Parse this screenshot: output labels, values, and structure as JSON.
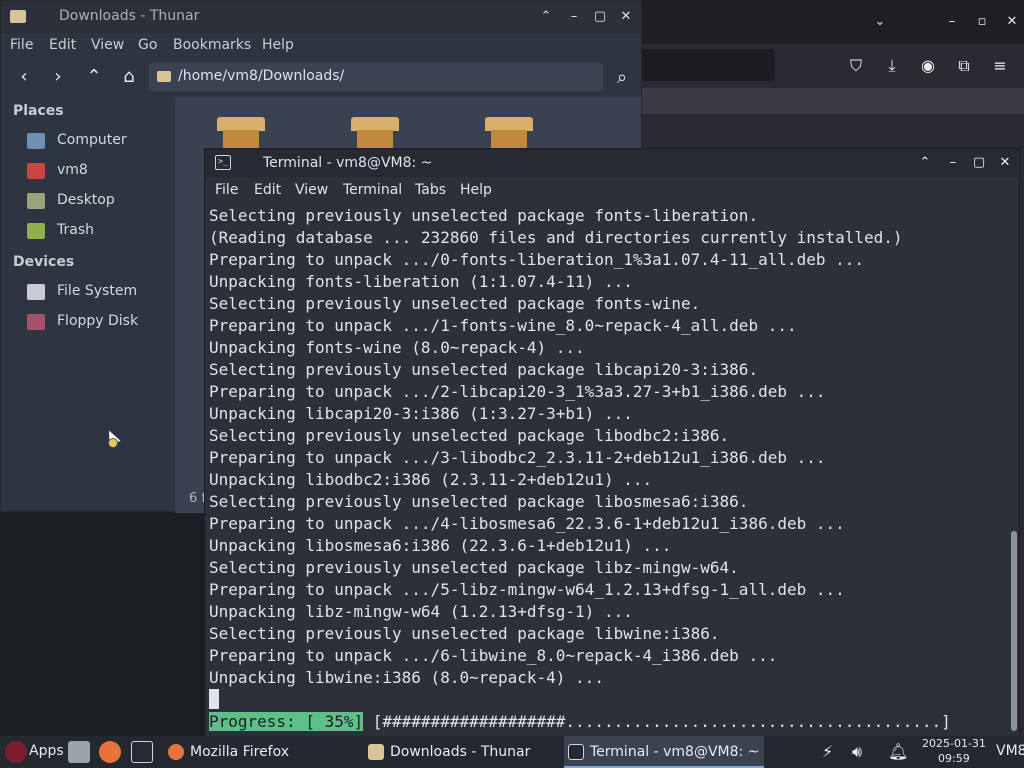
{
  "firefox": {
    "titlebar_controls": [
      "⌄",
      "–",
      "▫",
      "✕"
    ],
    "toolbar_icons": [
      "pocket-icon",
      "download-icon",
      "account-icon",
      "extensions-icon",
      "menu-icon"
    ]
  },
  "thunar": {
    "title": "Downloads - Thunar",
    "menu": [
      "File",
      "Edit",
      "View",
      "Go",
      "Bookmarks",
      "Help"
    ],
    "path": "/home/vm8/Downloads/",
    "places_header": "Places",
    "places": [
      {
        "label": "Computer",
        "icon": "computer-icon"
      },
      {
        "label": "vm8",
        "icon": "home-icon"
      },
      {
        "label": "Desktop",
        "icon": "desktop-icon"
      },
      {
        "label": "Trash",
        "icon": "trash-icon"
      }
    ],
    "devices_header": "Devices",
    "devices": [
      {
        "label": "File System",
        "icon": "drive-icon"
      },
      {
        "label": "Floppy Disk",
        "icon": "floppy-icon"
      }
    ],
    "status": "6 f"
  },
  "terminal": {
    "title": "Terminal - vm8@VM8: ~",
    "menu": [
      "File",
      "Edit",
      "View",
      "Terminal",
      "Tabs",
      "Help"
    ],
    "lines": [
      "Selecting previously unselected package fonts-liberation.",
      "(Reading database ... 232860 files and directories currently installed.)",
      "Preparing to unpack .../0-fonts-liberation_1%3a1.07.4-11_all.deb ...",
      "Unpacking fonts-liberation (1:1.07.4-11) ...",
      "Selecting previously unselected package fonts-wine.",
      "Preparing to unpack .../1-fonts-wine_8.0~repack-4_all.deb ...",
      "Unpacking fonts-wine (8.0~repack-4) ...",
      "Selecting previously unselected package libcapi20-3:i386.",
      "Preparing to unpack .../2-libcapi20-3_1%3a3.27-3+b1_i386.deb ...",
      "Unpacking libcapi20-3:i386 (1:3.27-3+b1) ...",
      "Selecting previously unselected package libodbc2:i386.",
      "Preparing to unpack .../3-libodbc2_2.3.11-2+deb12u1_i386.deb ...",
      "Unpacking libodbc2:i386 (2.3.11-2+deb12u1) ...",
      "Selecting previously unselected package libosmesa6:i386.",
      "Preparing to unpack .../4-libosmesa6_22.3.6-1+deb12u1_i386.deb ...",
      "Unpacking libosmesa6:i386 (22.3.6-1+deb12u1) ...",
      "Selecting previously unselected package libz-mingw-w64.",
      "Preparing to unpack .../5-libz-mingw-w64_1.2.13+dfsg-1_all.deb ...",
      "Unpacking libz-mingw-w64 (1.2.13+dfsg-1) ...",
      "Selecting previously unselected package libwine:i386.",
      "Preparing to unpack .../6-libwine_8.0~repack-4_i386.deb ...",
      "Unpacking libwine:i386 (8.0~repack-4) ..."
    ],
    "progress_label": "Progress: [ 35%]",
    "progress_bar": "[###################.......................................]",
    "progress_percent": 35
  },
  "taskbar": {
    "apps_label": "Apps",
    "tasks": [
      {
        "label": "Mozilla Firefox",
        "icon": "firefox-icon"
      },
      {
        "label": "Downloads - Thunar",
        "icon": "folder-icon"
      },
      {
        "label": "Terminal - vm8@VM8: ~",
        "icon": "terminal-icon"
      }
    ],
    "date": "2025-01-31",
    "time": "09:59",
    "user": "VM8"
  }
}
